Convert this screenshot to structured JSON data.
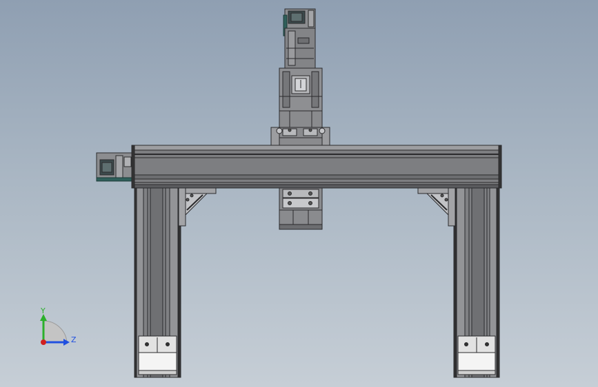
{
  "viewport": {
    "background_top": "#8f9fb2",
    "background_bottom": "#c6ced6"
  },
  "model": {
    "frame_color": "#7f8083",
    "frame_dark": "#3a3b3d",
    "motor_accent": "#2f5f5a",
    "carriage_color": "#8a8b8e",
    "foot_block_color": "#ffffff"
  },
  "triad": {
    "y_label": "Y",
    "z_label": "Z",
    "y_color": "#2bb02b",
    "z_color": "#2050e0",
    "origin_color": "#d02020"
  }
}
